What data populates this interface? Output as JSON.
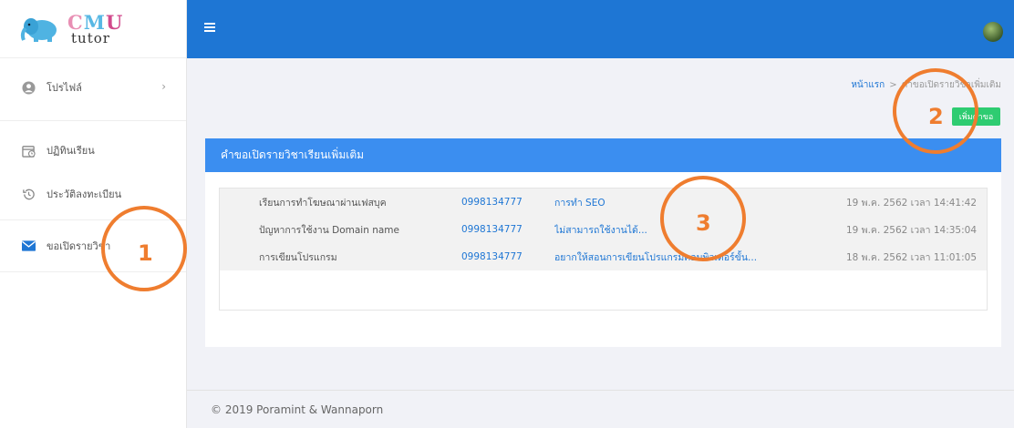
{
  "logo": {
    "part1": "C",
    "part2": "M",
    "part3": "U",
    "sub": "tutor"
  },
  "sidebar": {
    "items": [
      {
        "label": "โปรไฟล์",
        "icon": "user-circle-icon",
        "has_chevron": true
      },
      {
        "label": "ปฏิทินเรียน",
        "icon": "calendar-icon"
      },
      {
        "label": "ประวัติลงทะเบียน",
        "icon": "history-icon"
      },
      {
        "label": "ขอเปิดรายวิชา",
        "icon": "envelope-icon"
      }
    ],
    "chevron": "›"
  },
  "header": {
    "menu_icon": "hamburger-icon",
    "avatar": "user-avatar"
  },
  "breadcrumb": {
    "home": "หน้าแรก",
    "separator": ">",
    "current": "คำขอเปิดรายวิชาเพิ่มเติม"
  },
  "add_button": {
    "label": "เพิ่มคำขอ",
    "color": "#2ecc71"
  },
  "card": {
    "title": "คำขอเปิดรายวิชาเรียนเพิ่มเติม",
    "rows": [
      {
        "subject": "เรียนการทำโฆษณาผ่านเฟสบุค",
        "phone": "0998134777",
        "message": "การทำ SEO",
        "date": "19 พ.ค. 2562 เวลา 14:41:42"
      },
      {
        "subject": "ปัญหาการใช้งาน Domain name",
        "phone": "0998134777",
        "message": "ไม่สามารถใช้งานได้...",
        "date": "19 พ.ค. 2562 เวลา 14:35:04"
      },
      {
        "subject": "การเขียนโปรแกรม",
        "phone": "0998134777",
        "message": "อยากให้สอนการเขียนโปรแกรมคอมพิวเตอร์ขั้น...",
        "date": "18 พ.ค. 2562 เวลา 11:01:05"
      }
    ]
  },
  "footer": {
    "text": "© 2019 Poramint & Wannaporn"
  },
  "annotations": [
    "1",
    "2",
    "3"
  ],
  "colors": {
    "topbar": "#1e76d4",
    "card_header": "#3b8ef0",
    "link": "#1e76d4",
    "annotation": "#ef7d2f"
  }
}
